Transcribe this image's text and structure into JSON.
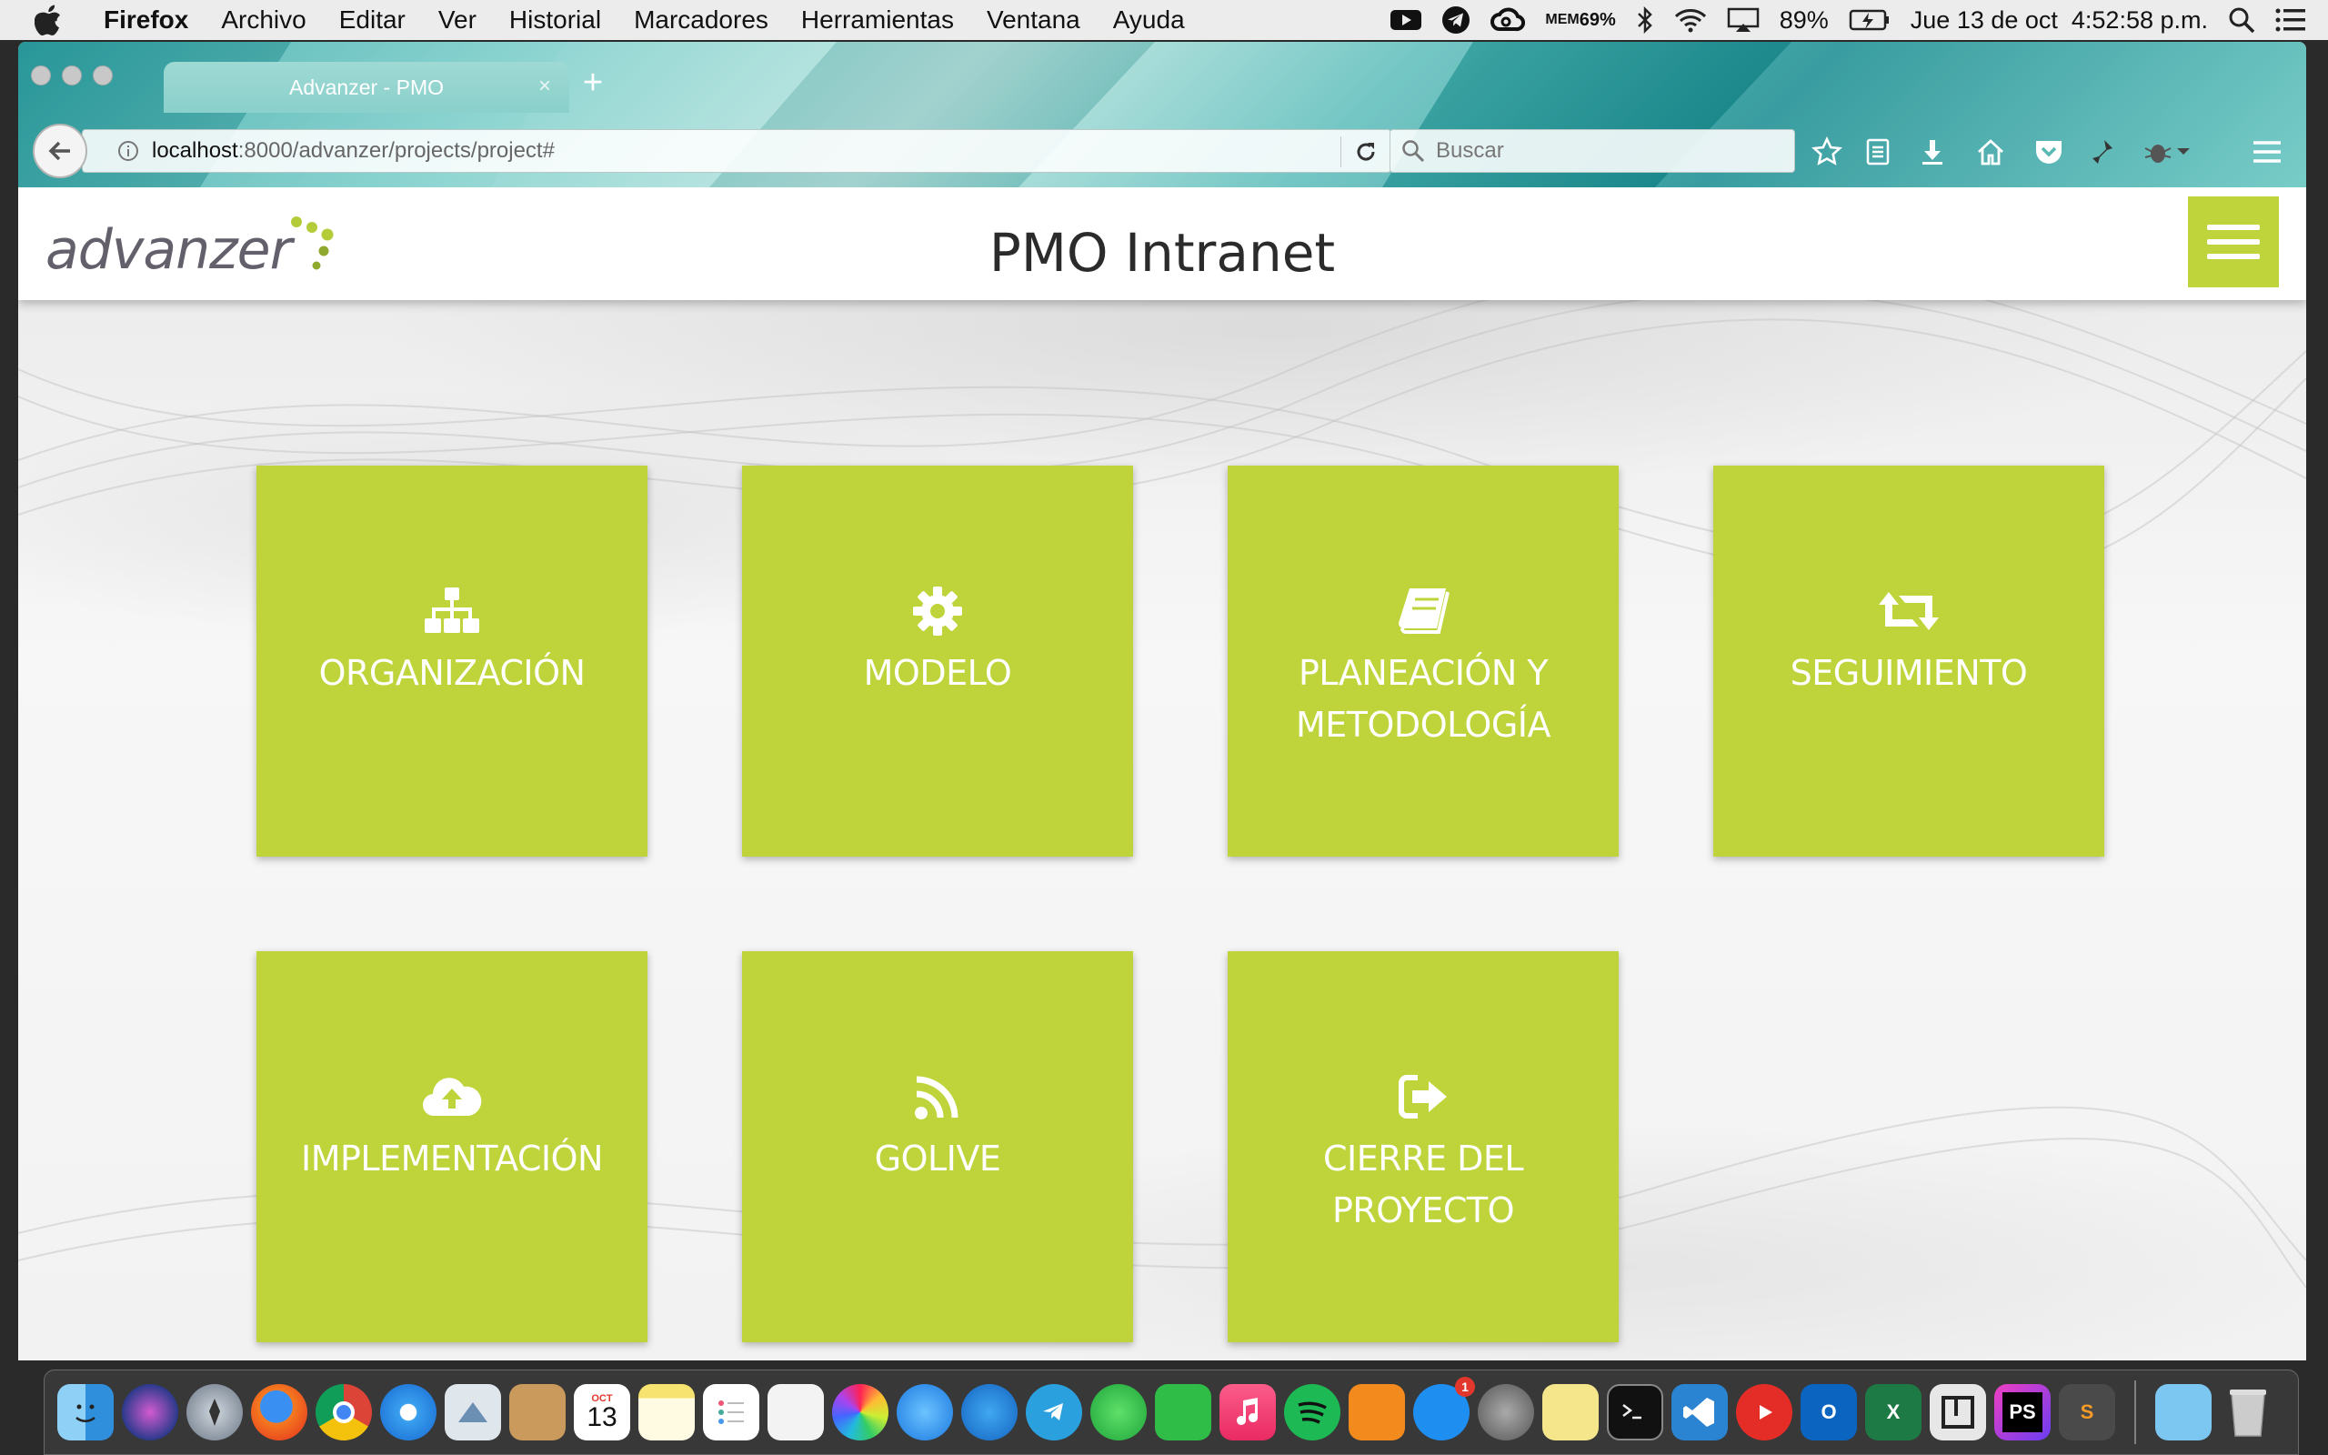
{
  "menubar": {
    "app_name": "Firefox",
    "items": [
      "Archivo",
      "Editar",
      "Ver",
      "Historial",
      "Marcadores",
      "Herramientas",
      "Ventana",
      "Ayuda"
    ],
    "mem_label": "MEM",
    "mem_value": "69%",
    "battery": "89%",
    "clock": "Jue 13 de oct  4:52:58 p.m."
  },
  "browser": {
    "tab_title": "Advanzer - PMO",
    "tab_close": "×",
    "new_tab": "+",
    "url_host": "localhost",
    "url_path": ":8000/advanzer/projects/project#",
    "search_placeholder": "Buscar"
  },
  "site": {
    "logo_text": "advanzer",
    "title": "PMO Intranet",
    "accent_color": "#bfd43a"
  },
  "tiles": [
    {
      "label": "ORGANIZACIÓN",
      "icon": "sitemap-icon"
    },
    {
      "label": "MODELO",
      "icon": "gear-icon"
    },
    {
      "label": "PLANEACIÓN Y METODOLOGÍA",
      "icon": "book-icon"
    },
    {
      "label": "SEGUIMIENTO",
      "icon": "retweet-icon"
    },
    {
      "label": "IMPLEMENTACIÓN",
      "icon": "cloud-upload-icon"
    },
    {
      "label": "GOLIVE",
      "icon": "rss-icon"
    },
    {
      "label": "CIERRE DEL PROYECTO",
      "icon": "sign-out-icon"
    }
  ],
  "dock": {
    "calendar_month": "OCT",
    "calendar_day": "13",
    "badge_count": "1",
    "outlook_letter": "O",
    "excel_letter": "X",
    "phpstorm_letters": "PS",
    "sublime_letter": "S"
  }
}
